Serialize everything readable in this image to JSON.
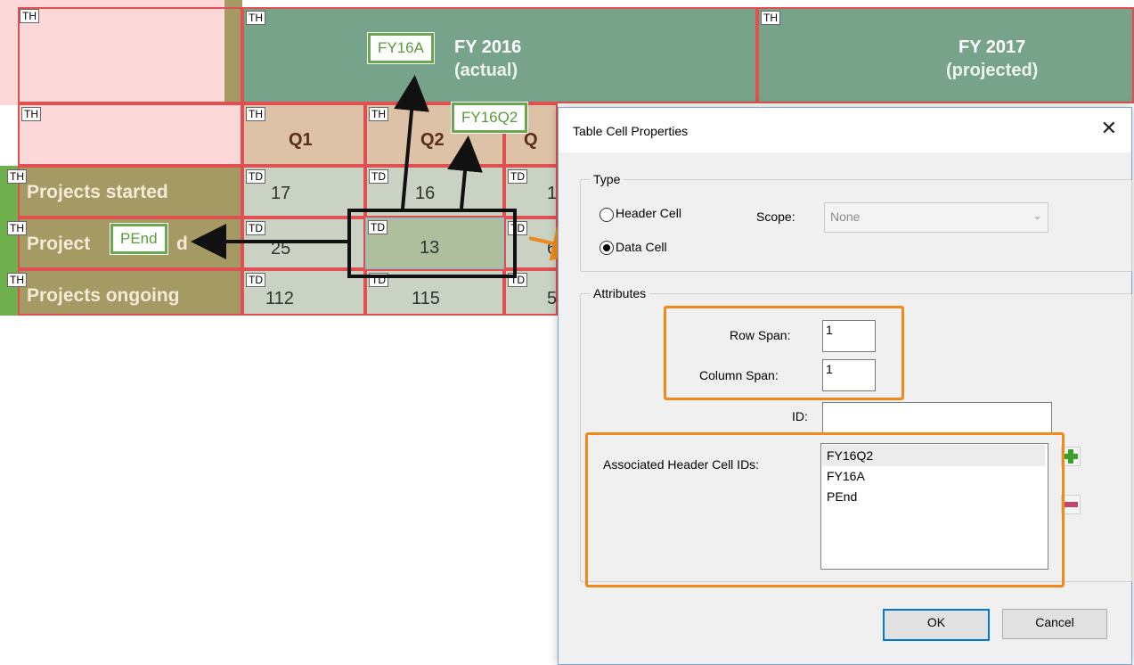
{
  "table": {
    "tag_th": "TH",
    "tag_td": "TD",
    "fy2016_line1": "FY 2016",
    "fy2016_line2": "(actual)",
    "fy2017_line1": "FY 2017",
    "fy2017_line2": "(projected)",
    "q1": "Q1",
    "q2": "Q2",
    "q3_partial": "Q",
    "rows": [
      {
        "label": "Projects started",
        "q1": "17",
        "q2": "16",
        "q3": "1"
      },
      {
        "label": "Project",
        "label_tail": "d",
        "q1": "25",
        "q2": "13",
        "q3": "6"
      },
      {
        "label": "Projects ongoing",
        "q1": "112",
        "q2": "115",
        "q3": "5"
      }
    ]
  },
  "callouts": {
    "fy16a": "FY16A",
    "fy16q2": "FY16Q2",
    "pend": "PEnd"
  },
  "dialog": {
    "title": "Table Cell Properties",
    "close_label": "✕",
    "type_group": "Type",
    "header_cell": "Header Cell",
    "data_cell": "Data Cell",
    "scope_label": "Scope:",
    "scope_value": "None",
    "attributes_group": "Attributes",
    "row_span_label": "Row Span:",
    "row_span_value": "1",
    "column_span_label": "Column Span:",
    "column_span_value": "1",
    "id_label": "ID:",
    "id_value": "",
    "assoc_label": "Associated Header Cell IDs:",
    "assoc_ids": [
      "FY16Q2",
      "FY16A",
      "PEnd"
    ],
    "ok_label": "OK",
    "cancel_label": "Cancel"
  },
  "colors": {
    "green_header": "#77a38a",
    "pink": "#fdd8d8",
    "tan": "#ddc2a8",
    "olive": "#a59a63",
    "accent_orange": "#f08a1c",
    "callout_green": "#6aa84f"
  }
}
